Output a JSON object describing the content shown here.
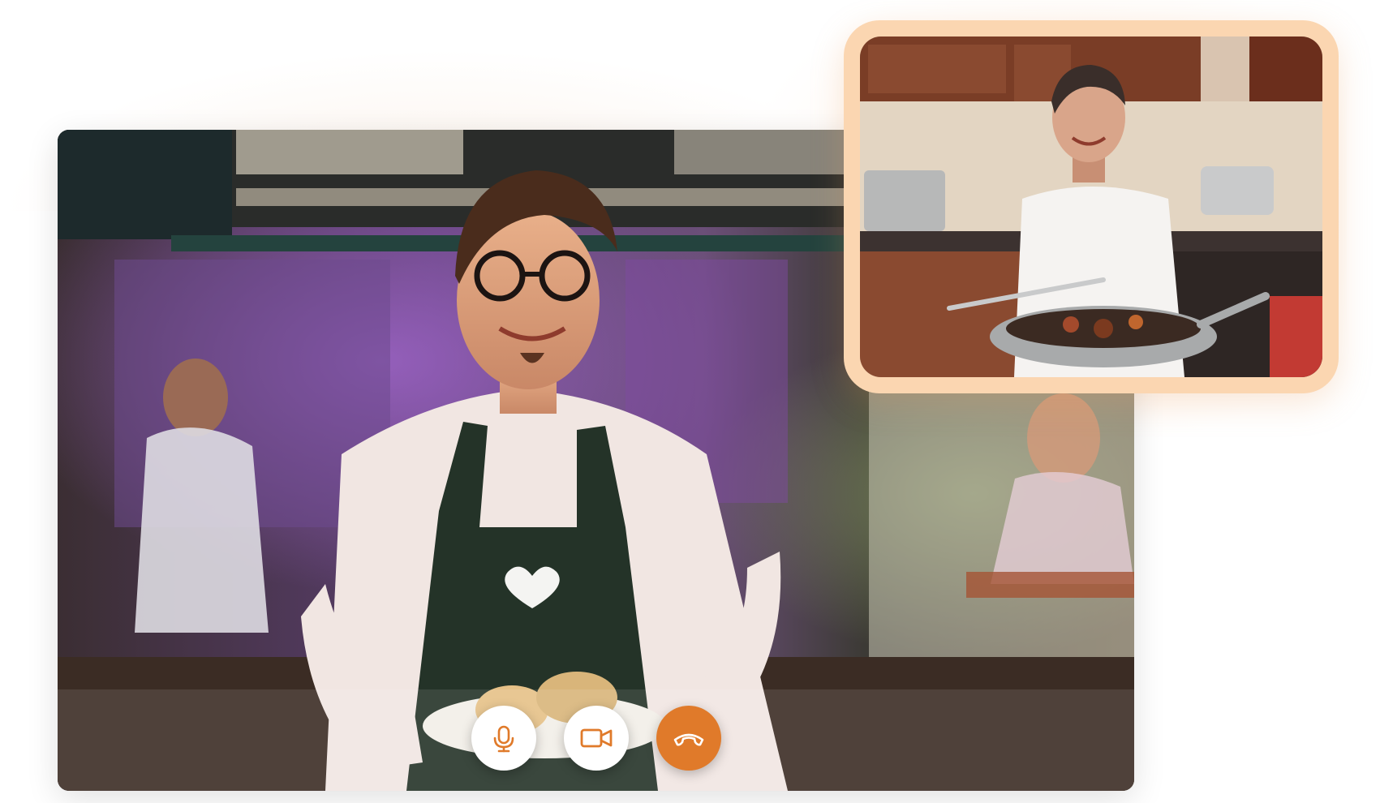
{
  "call": {
    "controls": [
      {
        "id": "mic",
        "label": "Microphone",
        "icon": "microphone-icon",
        "color": "#e07a2a"
      },
      {
        "id": "camera",
        "label": "Camera",
        "icon": "video-camera-icon",
        "color": "#e07a2a"
      },
      {
        "id": "end",
        "label": "End call",
        "icon": "hang-up-icon",
        "color": "#ffffff",
        "background": "#e07a2a"
      }
    ]
  },
  "colors": {
    "accent": "#e07a2a",
    "pip_frame": "#fbd6b1"
  }
}
